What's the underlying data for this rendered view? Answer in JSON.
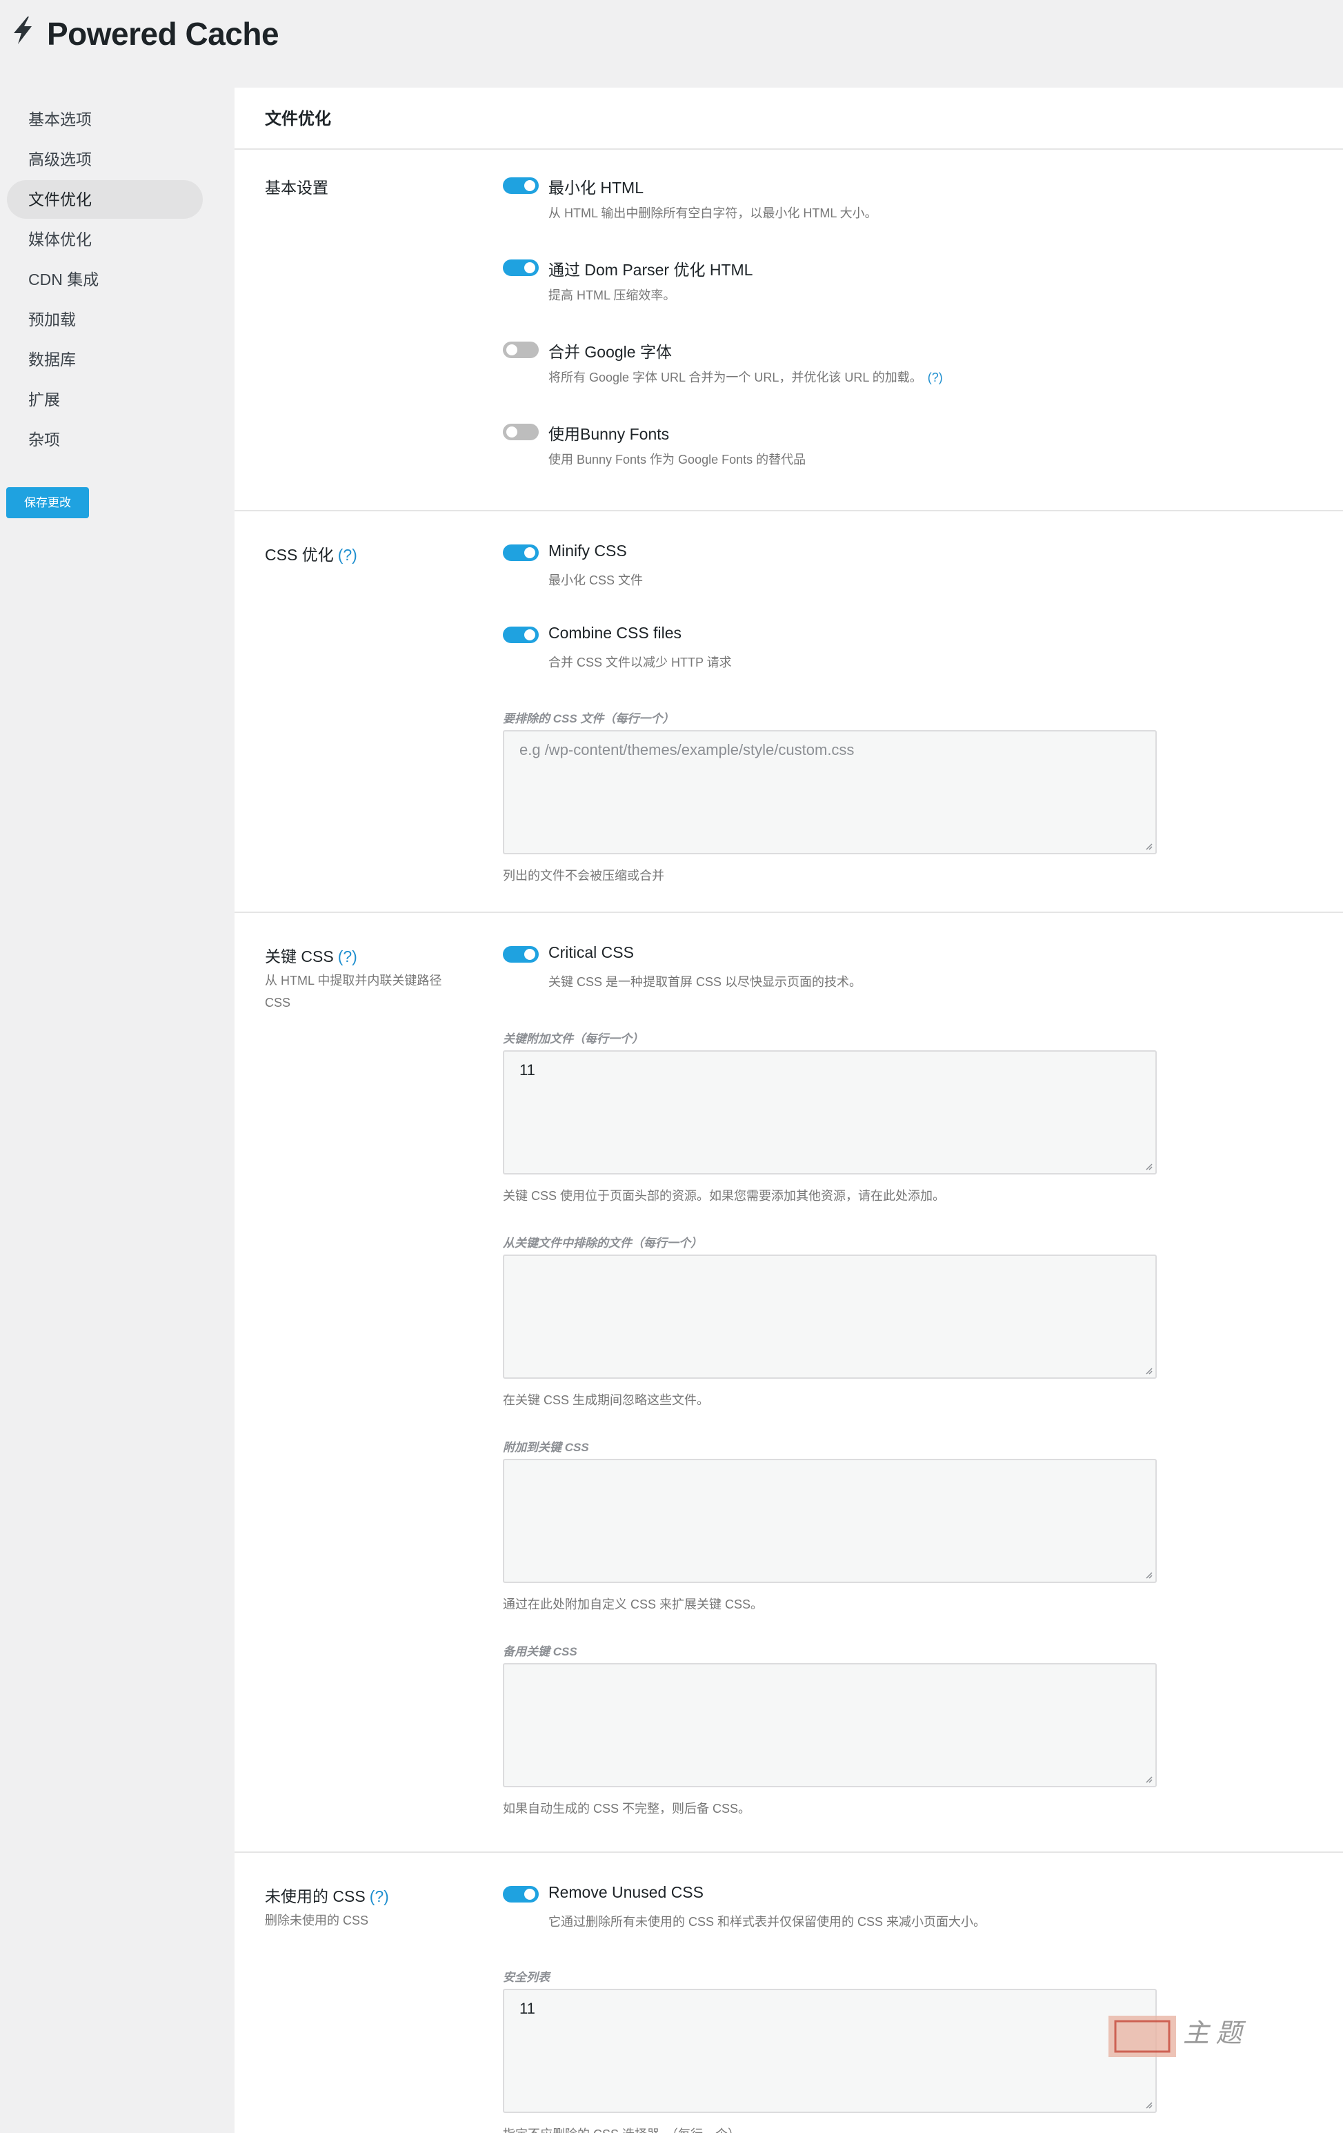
{
  "app": {
    "title": "Powered Cache"
  },
  "sidebar": {
    "items": [
      {
        "label": "基本选项"
      },
      {
        "label": "高级选项"
      },
      {
        "label": "文件优化"
      },
      {
        "label": "媒体优化"
      },
      {
        "label": "CDN 集成"
      },
      {
        "label": "预加载"
      },
      {
        "label": "数据库"
      },
      {
        "label": "扩展"
      },
      {
        "label": "杂项"
      }
    ],
    "active_index": 2,
    "save_label": "保存更改"
  },
  "page": {
    "heading": "文件优化"
  },
  "help_mark": "(?)",
  "sections": {
    "basic": {
      "label": "基本设置",
      "options": [
        {
          "title": "最小化 HTML",
          "desc": "从 HTML 输出中删除所有空白字符，以最小化 HTML 大小。",
          "enabled": true
        },
        {
          "title": "通过 Dom Parser 优化 HTML",
          "desc": "提高 HTML 压缩效率。",
          "enabled": true
        },
        {
          "title": "合并 Google 字体",
          "desc": "将所有 Google 字体 URL 合并为一个 URL，并优化该 URL 的加载。",
          "enabled": false
        },
        {
          "title": "使用Bunny Fonts",
          "desc": "使用 Bunny Fonts 作为 Google Fonts 的替代品",
          "enabled": false
        }
      ]
    },
    "css": {
      "label": "CSS 优化",
      "options": [
        {
          "title": "Minify CSS",
          "desc": "最小化 CSS 文件",
          "enabled": true
        },
        {
          "title": "Combine CSS files",
          "desc": "合并 CSS 文件以减少 HTTP 请求",
          "enabled": true
        }
      ],
      "exclude": {
        "label": "要排除的 CSS 文件（每行一个）",
        "placeholder": "e.g /wp-content/themes/example/style/custom.css",
        "value": "",
        "help": "列出的文件不会被压缩或合并"
      }
    },
    "critical": {
      "label": "关键 CSS",
      "desc": "从 HTML 中提取并内联关键路径 CSS",
      "option": {
        "title": "Critical CSS",
        "desc": "关键 CSS 是一种提取首屏 CSS 以尽快显示页面的技术。",
        "enabled": true
      },
      "fields": [
        {
          "label": "关键附加文件（每行一个）",
          "value": "11",
          "help": "关键 CSS 使用位于页面头部的资源。如果您需要添加其他资源，请在此处添加。"
        },
        {
          "label": "从关键文件中排除的文件（每行一个）",
          "value": "",
          "help": "在关键 CSS 生成期间忽略这些文件。"
        },
        {
          "label": "附加到关键 CSS",
          "value": "",
          "help": "通过在此处附加自定义 CSS 来扩展关键 CSS。"
        },
        {
          "label": "备用关键 CSS",
          "value": "",
          "help": "如果自动生成的 CSS 不完整，则后备 CSS。"
        }
      ]
    },
    "unused": {
      "label": "未使用的 CSS",
      "desc": "删除未使用的 CSS",
      "option": {
        "title": "Remove Unused CSS",
        "desc": "它通过删除所有未使用的 CSS 和样式表并仅保留使用的 CSS 来减小页面大小。",
        "enabled": true
      },
      "safelist": {
        "label": "安全列表",
        "value": "11",
        "help": "指定不应删除的 CSS 选择器。（每行一个）"
      }
    }
  },
  "watermark": {
    "text": "主题"
  }
}
